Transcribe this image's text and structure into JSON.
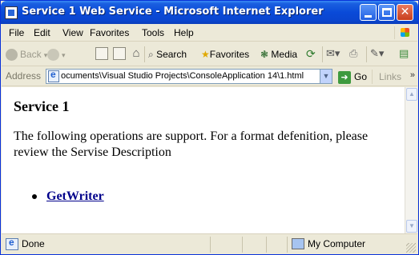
{
  "window": {
    "title": "Service 1 Web Service - Microsoft Internet Explorer"
  },
  "menu": {
    "file": "File",
    "edit": "Edit",
    "view": "View",
    "favorites": "Favorites",
    "tools": "Tools",
    "help": "Help"
  },
  "toolbar": {
    "back": "Back",
    "search": "Search",
    "favorites": "Favorites",
    "media": "Media"
  },
  "address": {
    "label": "Address",
    "value": "ocuments\\Visual Studio Projects\\ConsoleApplication 14\\1.html",
    "go": "Go",
    "links": "Links"
  },
  "page": {
    "title": "Service 1",
    "intro": "The following operations are support. For a format defenition, please review the Servise Description",
    "operations": [
      "GetWriter"
    ]
  },
  "status": {
    "text": "Done",
    "zone": "My Computer"
  },
  "colors": {
    "titlebar": "#0a4ad8",
    "chrome": "#ece9d8",
    "link": "#00008b"
  }
}
